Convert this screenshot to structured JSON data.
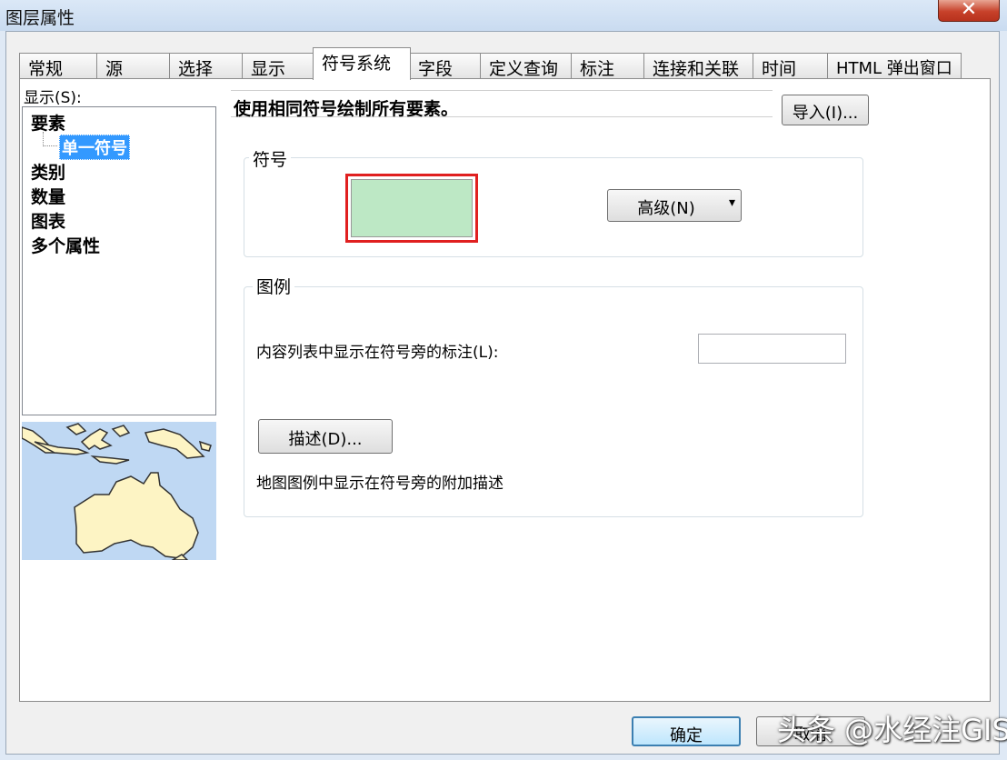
{
  "window": {
    "title": "图层属性",
    "close_symbol": "✕"
  },
  "tabs": [
    {
      "label": "常规"
    },
    {
      "label": "源"
    },
    {
      "label": "选择"
    },
    {
      "label": "显示"
    },
    {
      "label": "符号系统",
      "active": true
    },
    {
      "label": "字段"
    },
    {
      "label": "定义查询"
    },
    {
      "label": "标注"
    },
    {
      "label": "连接和关联"
    },
    {
      "label": "时间"
    },
    {
      "label": "HTML 弹出窗口"
    }
  ],
  "show": {
    "label": "显示(S):",
    "tree": [
      {
        "label": "要素"
      },
      {
        "label": "单一符号",
        "selected": true
      },
      {
        "label": "类别"
      },
      {
        "label": "数量"
      },
      {
        "label": "图表"
      },
      {
        "label": "多个属性"
      }
    ]
  },
  "renderer_description": "使用相同符号绘制所有要素。",
  "import_button": "导入(I)...",
  "symbol": {
    "group_title": "符号",
    "fill_color": "#bde8c5",
    "outline_color": "#e02020",
    "advanced_button": "高级(N)",
    "dropdown_arrow": "▾"
  },
  "legend": {
    "group_title": "图例",
    "label_text": "内容列表中显示在符号旁的标注(L):",
    "label_value": "",
    "description_button": "描述(D)...",
    "description_hint": "地图图例中显示在符号旁的附加描述"
  },
  "footer": {
    "ok": "确定",
    "cancel": "取消"
  },
  "watermark": "头条 @水经注GIS",
  "colors": {
    "selection": "#3399ff",
    "map_water": "#bfd8f3",
    "map_land": "#fdf4c4"
  }
}
